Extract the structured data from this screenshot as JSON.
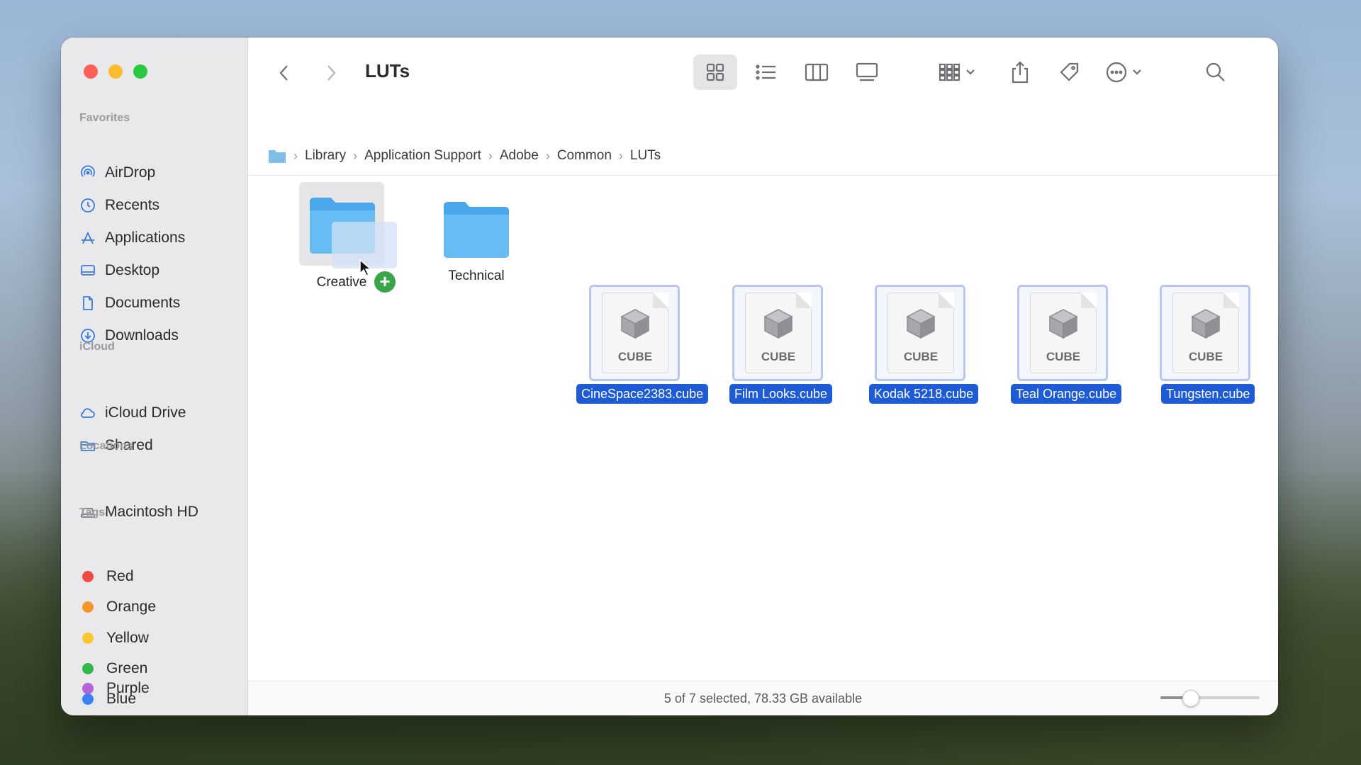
{
  "window": {
    "title": "LUTs"
  },
  "sidebar": {
    "sections": {
      "favorites": "Favorites",
      "icloud": "iCloud",
      "locations": "Locations",
      "tags": "Tags"
    },
    "favorites": [
      {
        "label": "AirDrop",
        "icon": "airdrop-icon"
      },
      {
        "label": "Recents",
        "icon": "clock-icon"
      },
      {
        "label": "Applications",
        "icon": "applications-icon"
      },
      {
        "label": "Desktop",
        "icon": "desktop-icon"
      },
      {
        "label": "Documents",
        "icon": "document-icon"
      },
      {
        "label": "Downloads",
        "icon": "download-icon"
      }
    ],
    "icloud": [
      {
        "label": "iCloud Drive",
        "icon": "cloud-icon"
      },
      {
        "label": "Shared",
        "icon": "shared-folder-icon"
      }
    ],
    "locations": [
      {
        "label": "Macintosh HD",
        "icon": "disk-icon"
      }
    ],
    "tags": [
      {
        "label": "Red",
        "color": "#f04a45"
      },
      {
        "label": "Orange",
        "color": "#f6962c"
      },
      {
        "label": "Yellow",
        "color": "#f8c82c"
      },
      {
        "label": "Green",
        "color": "#34b84a"
      },
      {
        "label": "Blue",
        "color": "#3a82f6"
      },
      {
        "label": "Purple",
        "color": "#b462d8"
      }
    ]
  },
  "pathbar": {
    "crumbs": [
      "Library",
      "Application Support",
      "Adobe",
      "Common",
      "LUTs"
    ]
  },
  "items": {
    "folders": [
      {
        "name": "Creative",
        "drop_target": true
      },
      {
        "name": "Technical",
        "drop_target": false
      }
    ],
    "files": [
      {
        "name": "CineSpace2383.cube",
        "kind": "CUBE",
        "selected": true
      },
      {
        "name": "Film Looks.cube",
        "kind": "CUBE",
        "selected": true
      },
      {
        "name": "Kodak 5218.cube",
        "kind": "CUBE",
        "selected": true
      },
      {
        "name": "Teal Orange.cube",
        "kind": "CUBE",
        "selected": true
      },
      {
        "name": "Tungsten.cube",
        "kind": "CUBE",
        "selected": true
      }
    ]
  },
  "status": {
    "text": "5 of 7 selected, 78.33 GB available",
    "icon_size_level": 0.3
  },
  "colors": {
    "accent": "#1e5bd6",
    "folder": "#5ab8f2"
  }
}
